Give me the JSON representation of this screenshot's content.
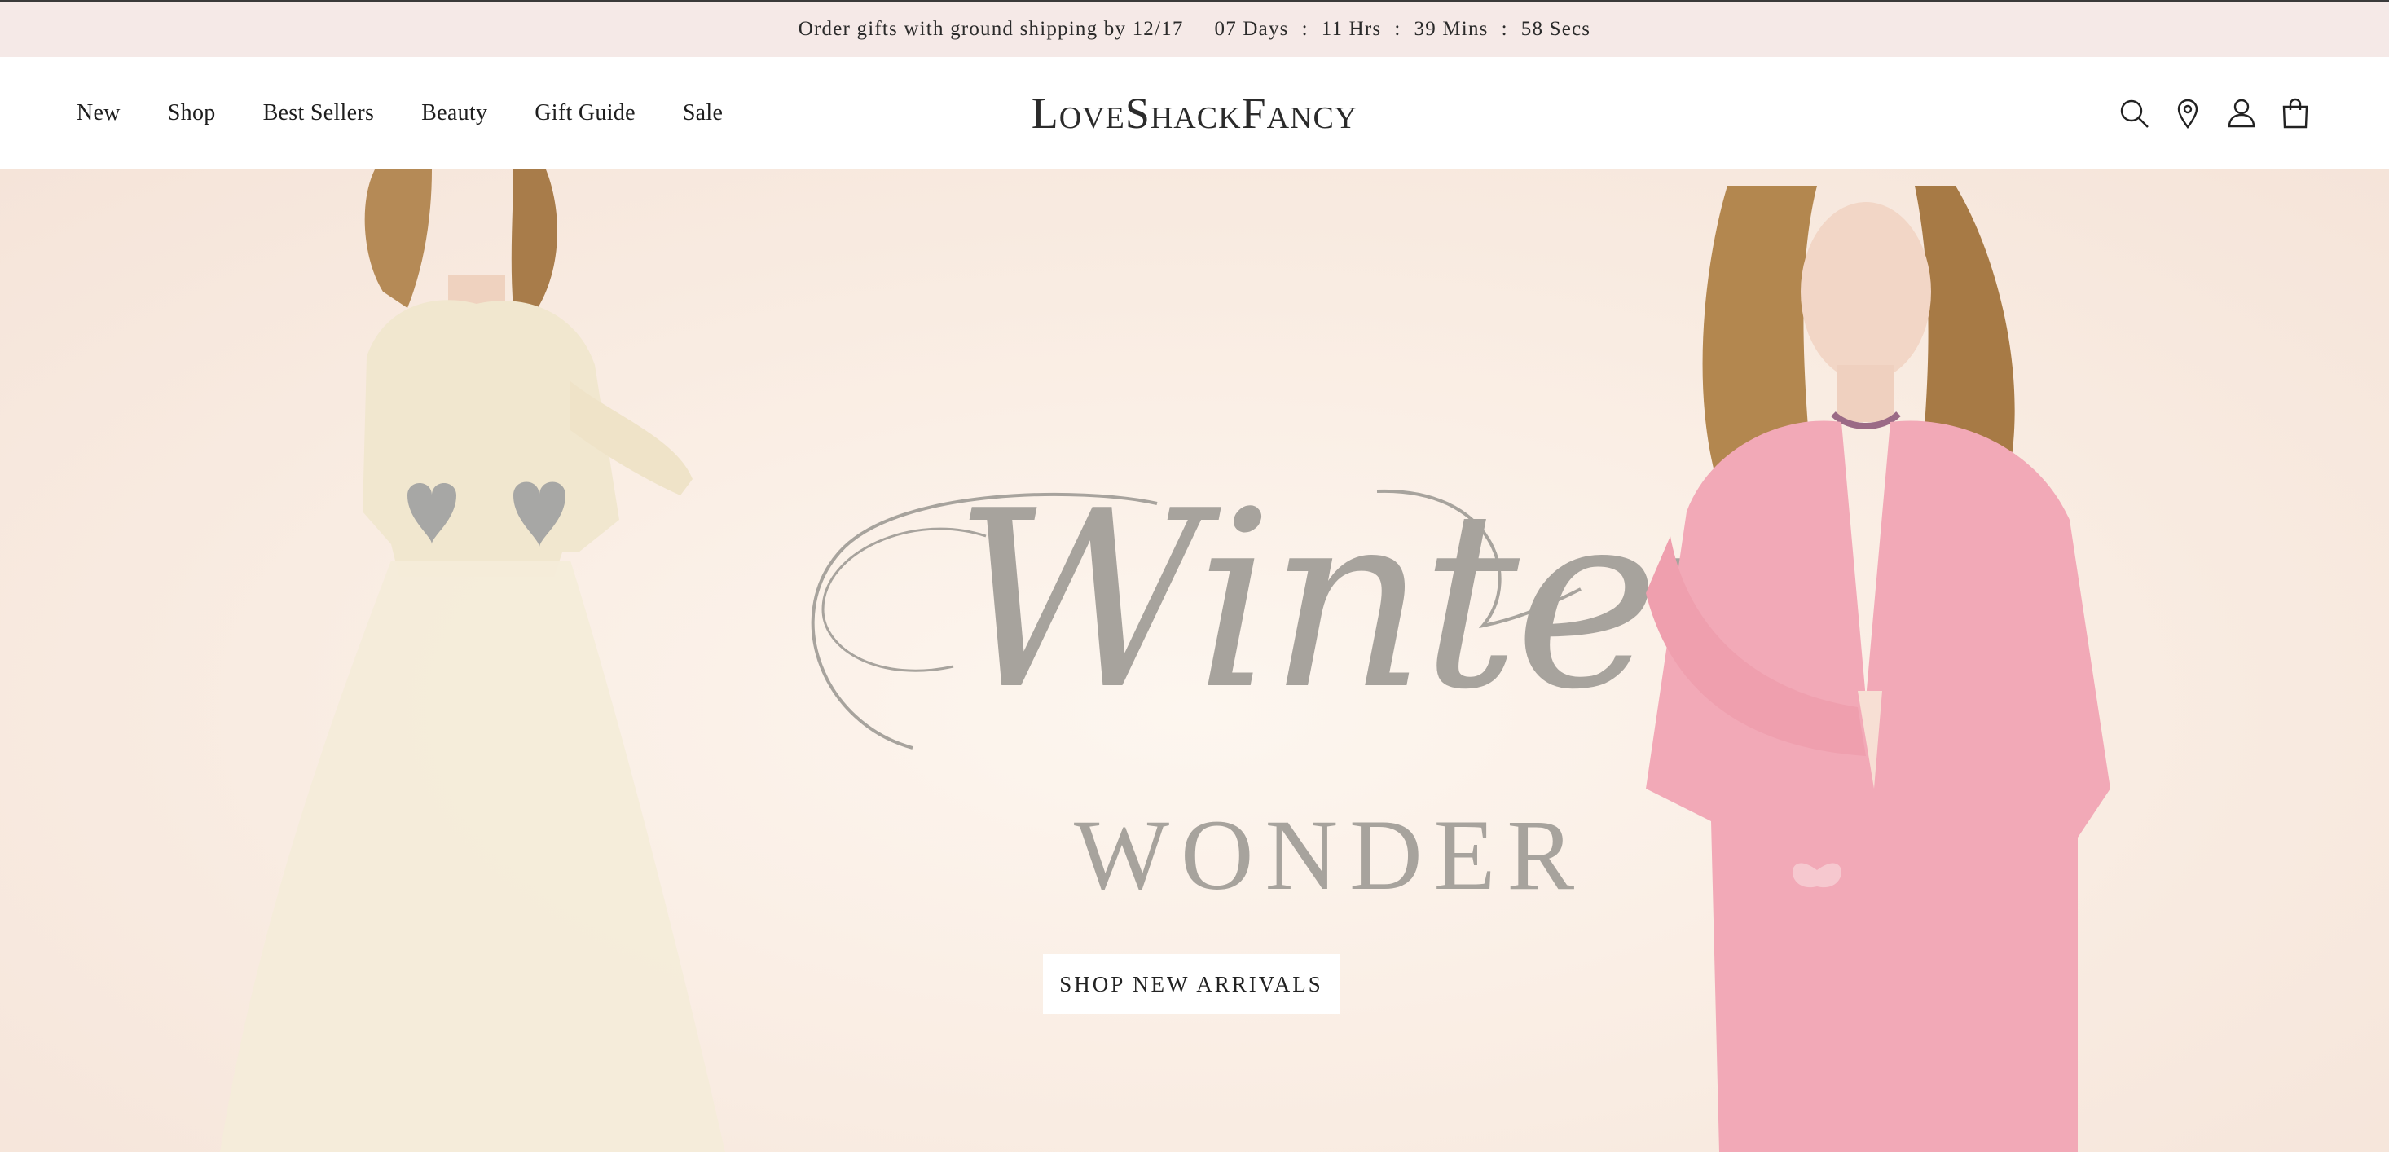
{
  "announcement": {
    "message": "Order gifts with ground shipping by 12/17",
    "countdown": {
      "days": "07 Days",
      "hours": "11 Hrs",
      "mins": "39 Mins",
      "secs": "58 Secs",
      "separator": ":"
    }
  },
  "header": {
    "brand": "LoveShackFancy",
    "nav": [
      {
        "label": "New"
      },
      {
        "label": "Shop"
      },
      {
        "label": "Best Sellers"
      },
      {
        "label": "Beauty"
      },
      {
        "label": "Gift Guide"
      },
      {
        "label": "Sale"
      }
    ],
    "icons": [
      "search-icon",
      "location-pin-icon",
      "account-icon",
      "shopping-bag-icon"
    ]
  },
  "hero": {
    "headline_script": "Winter",
    "headline_caps": "WONDER",
    "cta_label": "SHOP NEW ARRIVALS",
    "colors": {
      "background": "#f9ece2",
      "headline": "#a7a39d",
      "cream_outfit": "#f1e7cf",
      "pink_outfit": "#f2a9b7"
    }
  }
}
